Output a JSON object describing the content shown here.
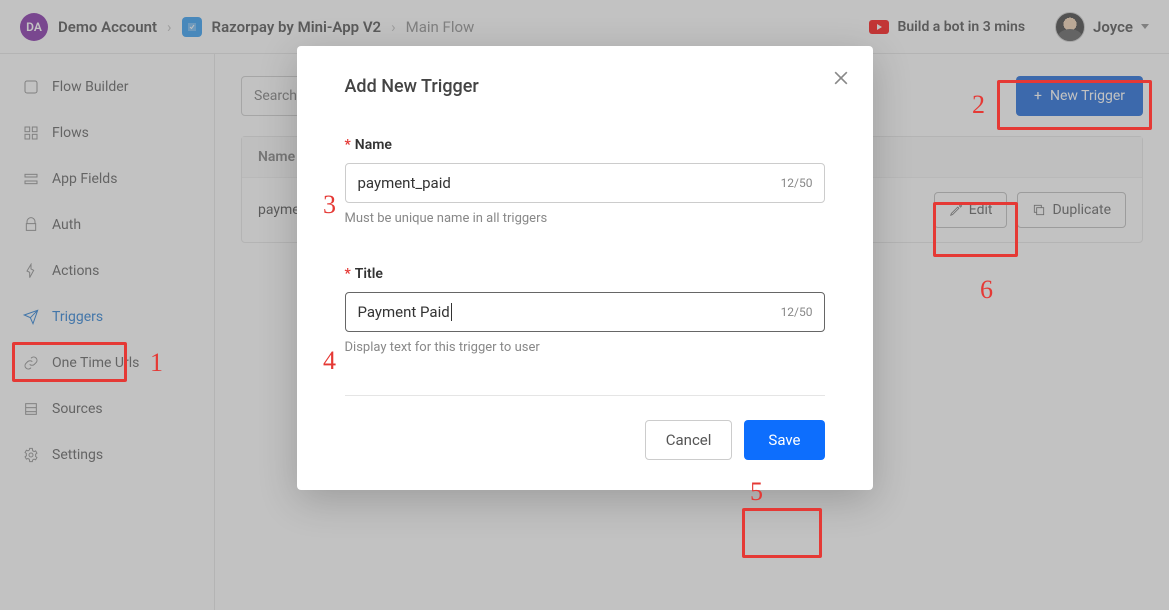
{
  "header": {
    "account_initials": "DA",
    "account_name": "Demo Account",
    "app_name": "Razorpay by Mini-App V2",
    "flow_name": "Main Flow",
    "promo_text": "Build a bot in 3 mins",
    "user_name": "Joyce"
  },
  "sidebar": {
    "items": [
      {
        "label": "Flow Builder"
      },
      {
        "label": "Flows"
      },
      {
        "label": "App Fields"
      },
      {
        "label": "Auth"
      },
      {
        "label": "Actions"
      },
      {
        "label": "Triggers"
      },
      {
        "label": "One Time Urls"
      },
      {
        "label": "Sources"
      },
      {
        "label": "Settings"
      }
    ]
  },
  "toolbar": {
    "search_placeholder": "Search",
    "new_trigger_label": "New Trigger"
  },
  "table": {
    "header_name": "Name",
    "row0_name": "payme",
    "edit_label": "Edit",
    "duplicate_label": "Duplicate"
  },
  "modal": {
    "title": "Add New Trigger",
    "name_label": "Name",
    "name_value": "payment_paid",
    "name_counter": "12/50",
    "name_hint": "Must be unique name in all triggers",
    "title_label": "Title",
    "title_value": "Payment Paid",
    "title_counter": "12/50",
    "title_hint": "Display text for this trigger to user",
    "cancel_label": "Cancel",
    "save_label": "Save"
  },
  "annotations": {
    "n1": "1",
    "n2": "2",
    "n3": "3",
    "n4": "4",
    "n5": "5",
    "n6": "6"
  }
}
